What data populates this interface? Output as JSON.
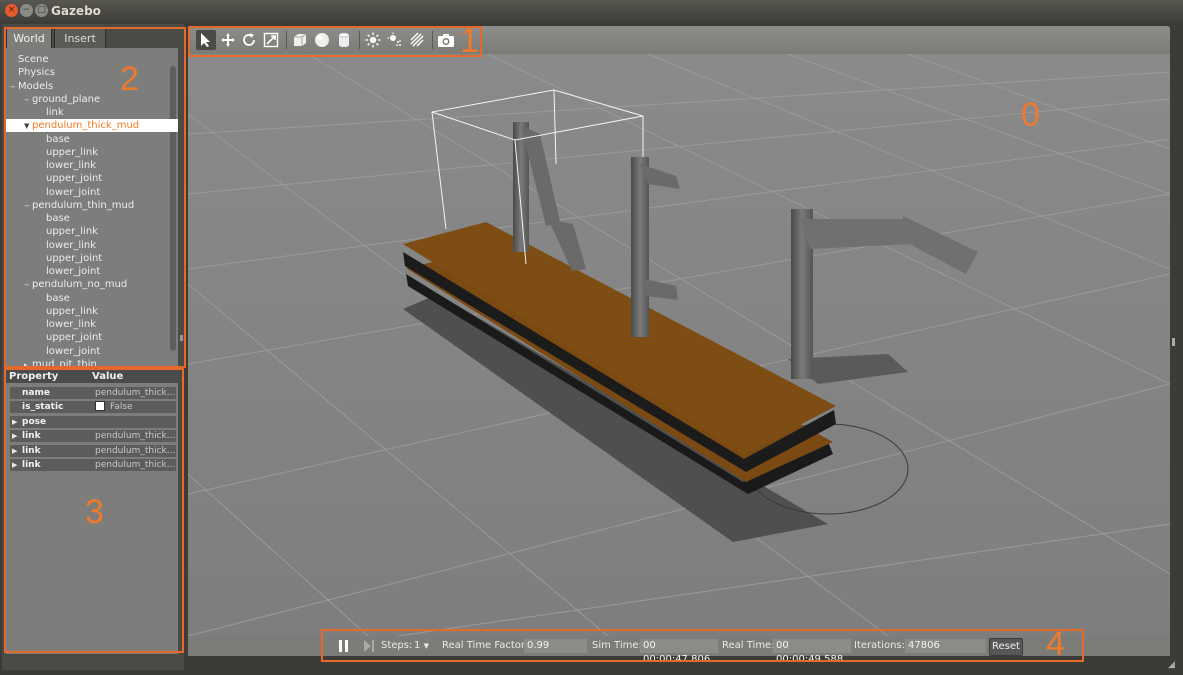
{
  "window": {
    "title": "Gazebo"
  },
  "tabs": [
    {
      "label": "World"
    },
    {
      "label": "Insert"
    }
  ],
  "tree": [
    {
      "label": "Scene",
      "indent": 0,
      "expander": ""
    },
    {
      "label": "Physics",
      "indent": 0,
      "expander": ""
    },
    {
      "label": "Models",
      "indent": 0,
      "expander": "−"
    },
    {
      "label": "ground_plane",
      "indent": 1,
      "expander": "−"
    },
    {
      "label": "link",
      "indent": 2,
      "expander": ""
    },
    {
      "label": "pendulum_thick_mud",
      "indent": 1,
      "expander": "▼",
      "selected": true
    },
    {
      "label": "base",
      "indent": 2,
      "expander": ""
    },
    {
      "label": "upper_link",
      "indent": 2,
      "expander": ""
    },
    {
      "label": "lower_link",
      "indent": 2,
      "expander": ""
    },
    {
      "label": "upper_joint",
      "indent": 2,
      "expander": ""
    },
    {
      "label": "lower_joint",
      "indent": 2,
      "expander": ""
    },
    {
      "label": "pendulum_thin_mud",
      "indent": 1,
      "expander": "−"
    },
    {
      "label": "base",
      "indent": 2,
      "expander": ""
    },
    {
      "label": "upper_link",
      "indent": 2,
      "expander": ""
    },
    {
      "label": "lower_link",
      "indent": 2,
      "expander": ""
    },
    {
      "label": "upper_joint",
      "indent": 2,
      "expander": ""
    },
    {
      "label": "lower_joint",
      "indent": 2,
      "expander": ""
    },
    {
      "label": "pendulum_no_mud",
      "indent": 1,
      "expander": "−"
    },
    {
      "label": "base",
      "indent": 2,
      "expander": ""
    },
    {
      "label": "upper_link",
      "indent": 2,
      "expander": ""
    },
    {
      "label": "lower_link",
      "indent": 2,
      "expander": ""
    },
    {
      "label": "upper_joint",
      "indent": 2,
      "expander": ""
    },
    {
      "label": "lower_joint",
      "indent": 2,
      "expander": ""
    },
    {
      "label": "mud_pit_thin",
      "indent": 1,
      "expander": "▸"
    }
  ],
  "properties": {
    "header": {
      "property": "Property",
      "value": "Value"
    },
    "rows": [
      {
        "key": "name",
        "value": "pendulum_thick...",
        "expandable": false
      },
      {
        "key": "is_static",
        "value": "False",
        "checkbox": true,
        "expandable": false
      },
      {
        "key": "pose",
        "value": "",
        "expandable": true
      },
      {
        "key": "link",
        "value": "pendulum_thick...",
        "expandable": true
      },
      {
        "key": "link",
        "value": "pendulum_thick...",
        "expandable": true
      },
      {
        "key": "link",
        "value": "pendulum_thick...",
        "expandable": true
      }
    ]
  },
  "toolbar": {
    "tools": [
      "select-arrow-icon",
      "translate-icon",
      "rotate-icon",
      "scale-icon",
      "box-icon",
      "sphere-icon",
      "cylinder-icon",
      "point-light-icon",
      "spot-light-icon",
      "directional-light-icon",
      "screenshot-icon"
    ]
  },
  "bottombar": {
    "steps_label": "Steps:",
    "steps_value": "1",
    "rtf_label": "Real Time Factor:",
    "rtf_value": "0.99",
    "simtime_label": "Sim Time:",
    "simtime_value": "00 00:00:47.806",
    "realtime_label": "Real Time:",
    "realtime_value": "00 00:00:49.588",
    "iterations_label": "Iterations:",
    "iterations_value": "47806",
    "reset_label": "Reset"
  },
  "annotations": [
    "0",
    "1",
    "2",
    "3",
    "4"
  ],
  "colors": {
    "accent": "#e4692a",
    "selected_text": "#f07c24",
    "board": "#7a4a12",
    "pendulum": "#6a6a6a"
  }
}
